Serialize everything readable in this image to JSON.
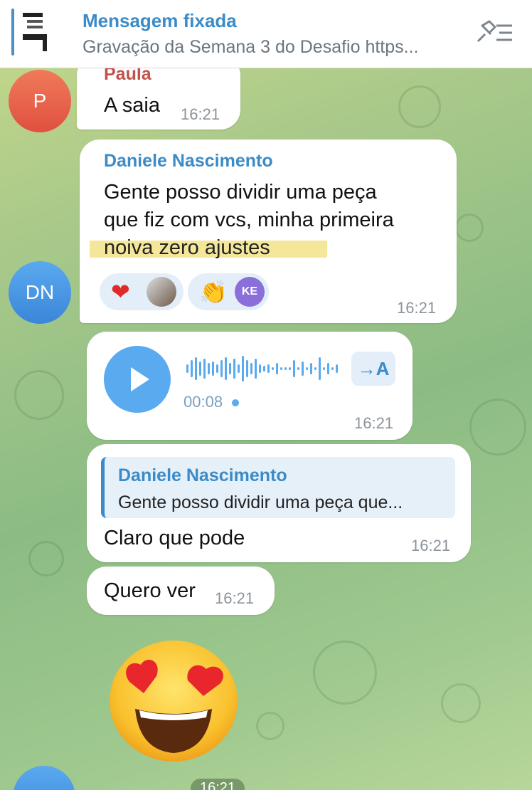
{
  "pinned": {
    "title": "Mensagem fixada",
    "text": "Gravação da Semana 3 do Desafio https..."
  },
  "messages": [
    {
      "sender": "Paula",
      "sender_color": "#c0524a",
      "avatar_initials": "P",
      "text": "A saia",
      "time": "16:21"
    },
    {
      "sender": "Daniele Nascimento",
      "sender_color": "#3a8bc7",
      "avatar_initials": "DN",
      "text_lines": [
        "Gente posso dividir uma peça",
        "que fiz com vcs, minha primeira",
        "noiva zero ajustes"
      ],
      "reactions": [
        {
          "emoji": "❤️",
          "icon": "heart-icon"
        },
        {
          "emoji": "👏",
          "icon": "clapping-hands-icon",
          "badge": "KE"
        }
      ],
      "time": "16:21"
    },
    {
      "type": "voice",
      "duration": "00:08",
      "transcribe_label": "→A",
      "time": "16:21"
    },
    {
      "reply": {
        "sender": "Daniele Nascimento",
        "text": "Gente posso dividir uma peça que..."
      },
      "text": "Claro que pode",
      "time": "16:21"
    },
    {
      "text": "Quero ver",
      "time": "16:21"
    },
    {
      "type": "sticker",
      "emoji": "😍",
      "icon": "heart-eyes-emoji",
      "time": "16:21"
    }
  ]
}
